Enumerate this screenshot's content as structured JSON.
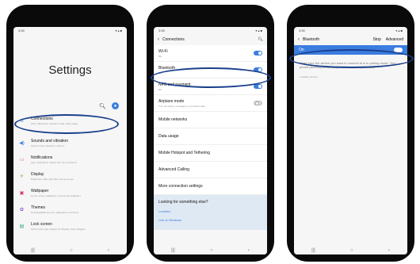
{
  "phone1": {
    "status_time": "3:55",
    "title": "Settings",
    "items": [
      {
        "label": "Connections",
        "sub": "Wi-Fi, Bluetooth, Airplane mode, Data usage",
        "icon": "wifi-icon",
        "color": "#3b7de0"
      },
      {
        "label": "Sounds and vibration",
        "sub": "Sound mode, Ringtone, Volume",
        "icon": "sound-icon",
        "color": "#3b7de0"
      },
      {
        "label": "Notifications",
        "sub": "App notifications, Status bar, Do not disturb",
        "icon": "notification-icon",
        "color": "#e0533b"
      },
      {
        "label": "Display",
        "sub": "Brightness, Blue light filter, Home screen",
        "icon": "display-icon",
        "color": "#7cc24a"
      },
      {
        "label": "Wallpaper",
        "sub": "Home screen wallpaper, Lock screen wallpaper",
        "icon": "wallpaper-icon",
        "color": "#d63a7a"
      },
      {
        "label": "Themes",
        "sub": "Downloadable themes, wallpapers, and icons",
        "icon": "themes-icon",
        "color": "#8a4fd6"
      },
      {
        "label": "Lock screen",
        "sub": "Screen lock type, Always On Display, Face Widgets",
        "icon": "lock-icon",
        "color": "#2aa88a"
      }
    ]
  },
  "phone2": {
    "status_time": "3:55",
    "title": "Connections",
    "rows": [
      {
        "label": "Wi-Fi",
        "sub": "On",
        "toggle": "on"
      },
      {
        "label": "Bluetooth",
        "sub": "On",
        "toggle": "on"
      },
      {
        "label": "NFC and payment",
        "sub": "On",
        "toggle": "on"
      },
      {
        "label": "Airplane mode",
        "sub": "Turn off calling, messaging, and Mobile data",
        "toggle": "off"
      },
      {
        "label": "Mobile networks",
        "sub": "",
        "toggle": ""
      },
      {
        "label": "Data usage",
        "sub": "",
        "toggle": ""
      },
      {
        "label": "Mobile Hotspot and Tethering",
        "sub": "",
        "toggle": ""
      },
      {
        "label": "Advanced Calling",
        "sub": "",
        "toggle": ""
      },
      {
        "label": "More connection settings",
        "sub": "",
        "toggle": ""
      }
    ],
    "looking_title": "Looking for something else?",
    "links": [
      "Location",
      "Link to Windows"
    ]
  },
  "phone3": {
    "status_time": "3:55",
    "title": "Bluetooth",
    "stop": "Stop",
    "advanced": "Advanced",
    "on_label": "On",
    "description": "Make sure the device you want to connect to is in pairing mode. Your phone (Android) is currently visible to nearby devices.",
    "available": "Available devices"
  },
  "colors": {
    "accent": "#3b7de0",
    "highlight_oval": "#1a3f8c"
  }
}
